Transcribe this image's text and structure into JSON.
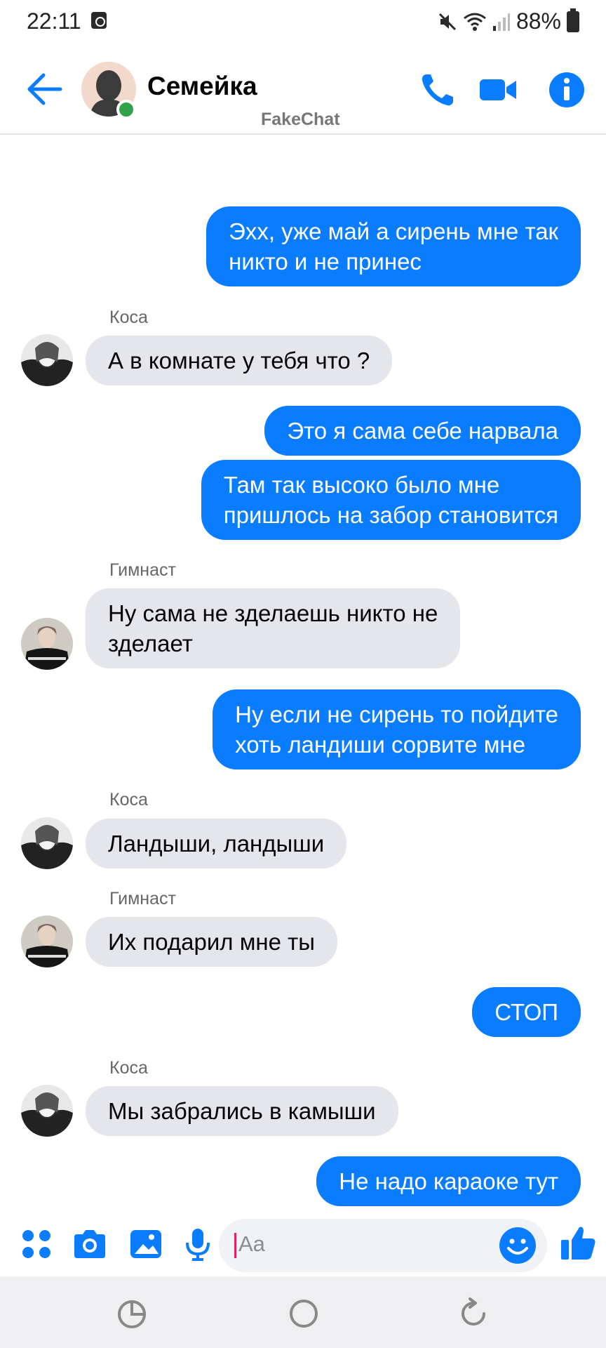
{
  "status_bar": {
    "time": "22:11",
    "battery": "88%"
  },
  "header": {
    "title": "Семейка",
    "watermark": "FakeChat",
    "icons": [
      "back-arrow-icon",
      "phone-icon",
      "video-camera-icon",
      "info-icon"
    ]
  },
  "messages": [
    {
      "type": "out",
      "text_lines": [
        "Эхх, уже май а сирень мне так",
        "никто и не принес"
      ]
    },
    {
      "type": "in",
      "sender": "Коса",
      "text": "А в комнате у тебя что ?"
    },
    {
      "type": "out",
      "text": "Это я сама себе нарвала"
    },
    {
      "type": "out",
      "text_lines": [
        "Там так высоко было мне",
        "пришлось на забор становится"
      ]
    },
    {
      "type": "in",
      "sender": "Гимнаст",
      "text_lines": [
        "Ну сама не зделаешь никто не",
        "зделает"
      ]
    },
    {
      "type": "out",
      "text_lines": [
        "Ну если не сирень то пойдите",
        "хоть ландиши сорвите мне"
      ]
    },
    {
      "type": "in",
      "sender": "Коса",
      "text": "Ландыши, ландыши"
    },
    {
      "type": "in",
      "sender": "Гимнаст",
      "text": "Их подарил мне ты"
    },
    {
      "type": "out",
      "text": "СТОП"
    },
    {
      "type": "in",
      "sender": "Коса",
      "text": "Мы забрались в камыши"
    },
    {
      "type": "out",
      "text": "Не надо караоке тут"
    }
  ],
  "composer": {
    "placeholder": "Aa",
    "icons": [
      "apps-grid-icon",
      "camera-icon",
      "gallery-icon",
      "microphone-icon",
      "emoji-icon",
      "thumbs-up-icon"
    ]
  },
  "colors": {
    "accent": "#0a7cff",
    "incoming_bubble": "#e4e6eb",
    "online": "#31a24c"
  }
}
